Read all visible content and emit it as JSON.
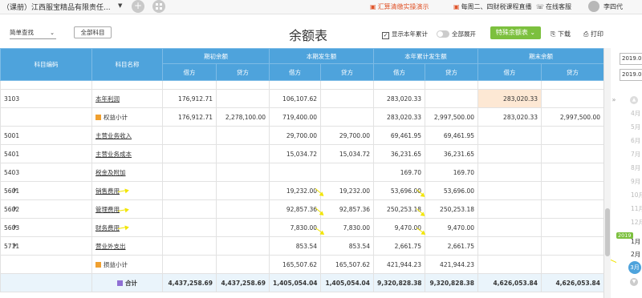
{
  "topbar": {
    "company": "（课册）江西服宝精品有限责任...",
    "company_caret": "▼",
    "add_icon": "plus-icon",
    "apps_icon": "grid-icon",
    "promo1": "汇算清缴实操演示",
    "promo2": "每周二、四财税课程直播",
    "service": "在线客服",
    "user": "李四代"
  },
  "toolbar": {
    "query_label": "简单查找",
    "subject_label": "全部科目",
    "title": "余额表",
    "show_cumulative": "显示本年累计",
    "expand_all": "全部展开",
    "special_label": "特殊余额表",
    "download": "下载",
    "print": "打印"
  },
  "colors": {
    "header_blue": "#4ea3dc",
    "green": "#7cc03e",
    "highlight": "#fde8d4",
    "arrow": "#f2e500"
  },
  "table": {
    "head": {
      "code": "科目编码",
      "name": "科目名称",
      "groups": [
        "期初余额",
        "本期发生额",
        "本年累计发生额",
        "期末余额"
      ],
      "debit": "借方",
      "credit": "贷方"
    },
    "rows": [
      {
        "code": "3103",
        "name": "本年利润",
        "link": true,
        "expander": false,
        "subtotal": false,
        "v": [
          "176,912.71",
          "",
          "106,107.62",
          "",
          "283,020.33",
          "",
          "283,020.33",
          ""
        ]
      },
      {
        "code": "",
        "name": "权益小计",
        "link": false,
        "expander": false,
        "subtotal": true,
        "v": [
          "176,912.71",
          "2,278,100.00",
          "719,400.00",
          "",
          "283,020.33",
          "2,997,500.00",
          "283,020.33",
          "2,997,500.00"
        ]
      },
      {
        "code": "5001",
        "name": "主营业务收入",
        "link": true,
        "expander": false,
        "subtotal": false,
        "v": [
          "",
          "",
          "29,700.00",
          "29,700.00",
          "69,461.95",
          "69,461.95",
          "",
          ""
        ]
      },
      {
        "code": "5401",
        "name": "主营业务成本",
        "link": true,
        "expander": false,
        "subtotal": false,
        "v": [
          "",
          "",
          "15,034.72",
          "15,034.72",
          "36,231.65",
          "36,231.65",
          "",
          ""
        ]
      },
      {
        "code": "5403",
        "name": "税金及附加",
        "link": true,
        "expander": false,
        "subtotal": false,
        "v": [
          "",
          "",
          "",
          "",
          "169.70",
          "169.70",
          "",
          ""
        ]
      },
      {
        "code": "5601",
        "name": "销售费用",
        "link": true,
        "expander": true,
        "subtotal": false,
        "v": [
          "",
          "",
          "19,232.00",
          "19,232.00",
          "53,696.00",
          "53,696.00",
          "",
          ""
        ]
      },
      {
        "code": "5602",
        "name": "管理费用",
        "link": true,
        "expander": true,
        "subtotal": false,
        "v": [
          "",
          "",
          "92,857.36",
          "92,857.36",
          "250,253.18",
          "250,253.18",
          "",
          ""
        ]
      },
      {
        "code": "5603",
        "name": "财务费用",
        "link": true,
        "expander": true,
        "subtotal": false,
        "v": [
          "",
          "",
          "7,830.00",
          "7,830.00",
          "9,470.00",
          "9,470.00",
          "",
          ""
        ]
      },
      {
        "code": "5711",
        "name": "营业外支出",
        "link": true,
        "expander": true,
        "subtotal": false,
        "v": [
          "",
          "",
          "853.54",
          "853.54",
          "2,661.75",
          "2,661.75",
          "",
          ""
        ]
      },
      {
        "code": "",
        "name": "损益小计",
        "link": false,
        "expander": false,
        "subtotal": true,
        "v": [
          "",
          "",
          "165,507.62",
          "165,507.62",
          "421,944.23",
          "421,944.23",
          "",
          ""
        ]
      }
    ],
    "total": {
      "name": "合计",
      "v": [
        "4,437,258.69",
        "4,437,258.69",
        "1,405,054.04",
        "1,405,054.04",
        "9,320,828.38",
        "9,320,828.38",
        "4,626,053.84",
        "4,626,053.84"
      ]
    }
  },
  "side": {
    "collapse": "»",
    "date_from": "2019.0",
    "date_to": "2019.0",
    "months_before": [
      "4月",
      "5月",
      "6月",
      "7月",
      "8月",
      "9月",
      "10月",
      "11月",
      "12月"
    ],
    "year_badge": "2019",
    "months_after": [
      "1月",
      "2月"
    ],
    "selected_month": "3月"
  }
}
